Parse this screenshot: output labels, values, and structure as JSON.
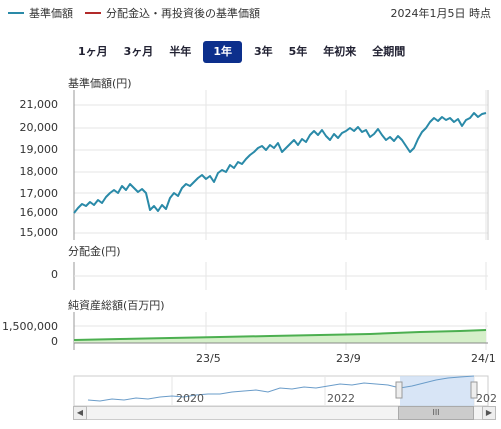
{
  "legend": {
    "items": [
      {
        "label": "基準価額",
        "color": "#2a8aa8"
      },
      {
        "label": "分配金込・再投資後の基準価額",
        "color": "#b22a2a"
      }
    ],
    "as_of": "2024年1月5日 時点"
  },
  "periods": {
    "items": [
      "1ヶ月",
      "3ヶ月",
      "半年",
      "1年",
      "3年",
      "5年",
      "年初来",
      "全期間"
    ],
    "active": "1年"
  },
  "panels": {
    "nav_title": "基準価額(円)",
    "dist_title": "分配金(円)",
    "assets_title": "純資産総額(百万円)"
  },
  "chart_data": [
    {
      "type": "line",
      "title": "基準価額(円)",
      "x": [
        "2023-01",
        "2023-02",
        "2023-03",
        "2023-04",
        "2023-05",
        "2023-06",
        "2023-07",
        "2023-08",
        "2023-09",
        "2023-10",
        "2023-11",
        "2023-12",
        "2024-01"
      ],
      "series": [
        {
          "name": "基準価額",
          "color": "#2a8aa8",
          "values": [
            16100,
            16300,
            16400,
            16350,
            16700,
            18100,
            18900,
            19400,
            19800,
            20300,
            19300,
            20700,
            20900
          ]
        }
      ],
      "yticks": [
        "21,000",
        "20,000",
        "19,000",
        "18,000",
        "17,000",
        "16,000",
        "15,000"
      ],
      "ylim": [
        15000,
        21400
      ],
      "xticks": [
        "23/5",
        "23/9",
        "24/1"
      ]
    },
    {
      "type": "line",
      "title": "分配金(円)",
      "yticks": [
        "0"
      ],
      "series": [
        {
          "values": [
            0,
            0,
            0,
            0,
            0,
            0,
            0,
            0,
            0,
            0,
            0,
            0,
            0
          ]
        }
      ]
    },
    {
      "type": "area",
      "title": "純資産総額(百万円)",
      "yticks": [
        "1,500,000",
        "0"
      ],
      "series": [
        {
          "color": "#4caf50"
        }
      ]
    }
  ],
  "navigator": {
    "labels": [
      "2020",
      "2022",
      "202"
    ],
    "thumb_glyph": "III",
    "left_arrow": "◀",
    "right_arrow": "▶"
  }
}
